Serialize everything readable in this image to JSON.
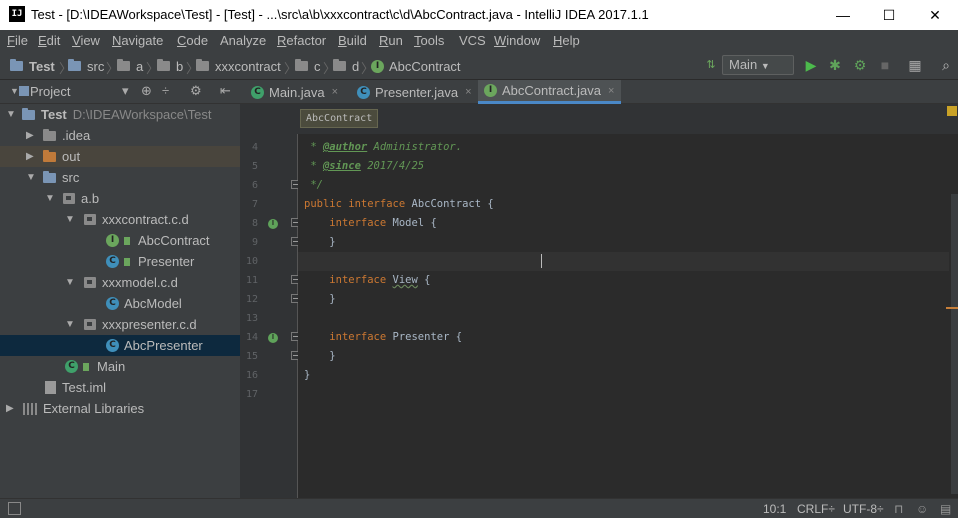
{
  "window": {
    "title": "Test - [D:\\IDEAWorkspace\\Test] - [Test] - ...\\src\\a\\b\\xxxcontract\\c\\d\\AbcContract.java - IntelliJ IDEA 2017.1.1",
    "app_icon_text": "IJ",
    "minimize": "—",
    "maximize": "☐",
    "close": "✕"
  },
  "menu": [
    {
      "key": "F",
      "rest": "ile"
    },
    {
      "key": "E",
      "rest": "dit"
    },
    {
      "key": "V",
      "rest": "iew"
    },
    {
      "key": "N",
      "rest": "avigate"
    },
    {
      "key": "C",
      "rest": "ode"
    },
    {
      "key": "",
      "rest": "Analyze"
    },
    {
      "key": "R",
      "rest": "efactor"
    },
    {
      "key": "B",
      "rest": "uild"
    },
    {
      "key": "R",
      "rest": "un"
    },
    {
      "key": "T",
      "rest": "ools"
    },
    {
      "key": "",
      "rest": "VCS"
    },
    {
      "key": "W",
      "rest": "indow"
    },
    {
      "key": "H",
      "rest": "elp"
    }
  ],
  "breadcrumbs": [
    "Test",
    "src",
    "a",
    "b",
    "xxxcontract",
    "c",
    "d",
    "AbcContract"
  ],
  "run_config": {
    "label": "Main",
    "arrow": "▼"
  },
  "project_panel": {
    "label": "Project"
  },
  "tree": {
    "root_label": "Test",
    "root_path": "D:\\IDEAWorkspace\\Test",
    "idea": ".idea",
    "out": "out",
    "src": "src",
    "ab": "a.b",
    "contract_pkg": "xxxcontract.c.d",
    "abc_contract": "AbcContract",
    "presenter": "Presenter",
    "model_pkg": "xxxmodel.c.d",
    "abc_model": "AbcModel",
    "presenter_pkg": "xxxpresenter.c.d",
    "abc_presenter": "AbcPresenter",
    "main": "Main",
    "test_iml": "Test.iml",
    "external_libraries": "External Libraries"
  },
  "tabs": [
    {
      "label": "Main.java",
      "close": "×"
    },
    {
      "label": "Presenter.java",
      "close": "×"
    },
    {
      "label": "AbcContract.java",
      "close": "×"
    }
  ],
  "editor_breadcrumb": "AbcContract",
  "line_numbers": [
    "4",
    "5",
    "6",
    "7",
    "8",
    "9",
    "10",
    "11",
    "12",
    "13",
    "14",
    "15",
    "16",
    "17"
  ],
  "code": {
    "l4_star": " * ",
    "l4_tag": "@author",
    "l4_val": " Administrator.",
    "l5_star": " * ",
    "l5_tag": "@since",
    "l5_val": " 2017/4/25",
    "l6": " */",
    "l7_kw1": "public",
    "l7_kw2": "interface",
    "l7_rest": " AbcContract {",
    "l8_kw": "interface",
    "l8_rest": " Model {",
    "l9": "    }",
    "l11_kw": "interface",
    "l11_name": "View",
    "l11_rest": " {",
    "l12": "    }",
    "l14_kw": "interface",
    "l14_rest": " Presenter {",
    "l15": "    }",
    "l16": "}"
  },
  "status": {
    "position": "10:1",
    "line_sep": "CRLF÷",
    "encoding": "UTF-8÷"
  }
}
